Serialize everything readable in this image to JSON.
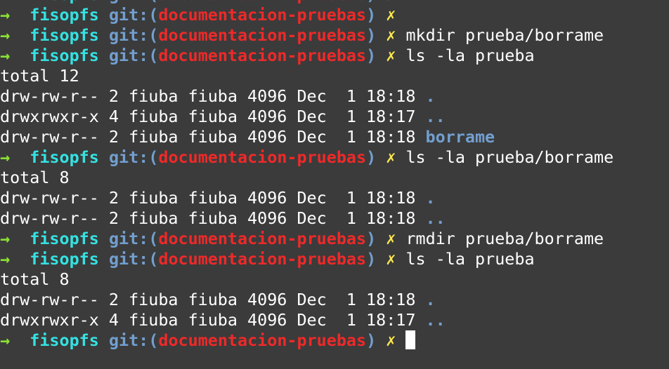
{
  "prompt": {
    "arrow": "→",
    "dir": "fisopfs",
    "git_open": "git:(",
    "branch": "documentacion-pruebas",
    "git_close": ")",
    "dirty": "✗"
  },
  "colors": {
    "background": "#3b3b3b",
    "arrow": "#8ae234",
    "dir": "#34e2e2",
    "git": "#729fcf",
    "branch": "#ef2929",
    "dirty": "#fce94f"
  },
  "lines": [
    {
      "type": "prompt",
      "cmd": ""
    },
    {
      "type": "prompt",
      "cmd": ""
    },
    {
      "type": "prompt",
      "cmd": "mkdir prueba/borrame"
    },
    {
      "type": "prompt",
      "cmd": "ls -la prueba"
    },
    {
      "type": "out",
      "text": "total 12"
    },
    {
      "type": "out",
      "text": "drw-rw-r-- 2 fiuba fiuba 4096 Dec  1 18:18 ",
      "name": "."
    },
    {
      "type": "out",
      "text": "drwxrwxr-x 4 fiuba fiuba 4096 Dec  1 18:17 ",
      "name": ".."
    },
    {
      "type": "out",
      "text": "drw-rw-r-- 2 fiuba fiuba 4096 Dec  1 18:18 ",
      "name": "borrame"
    },
    {
      "type": "prompt",
      "cmd": "ls -la prueba/borrame"
    },
    {
      "type": "out",
      "text": "total 8"
    },
    {
      "type": "out",
      "text": "drw-rw-r-- 2 fiuba fiuba 4096 Dec  1 18:18 ",
      "name": "."
    },
    {
      "type": "out",
      "text": "drw-rw-r-- 2 fiuba fiuba 4096 Dec  1 18:18 ",
      "name": ".."
    },
    {
      "type": "prompt",
      "cmd": "rmdir prueba/borrame"
    },
    {
      "type": "prompt",
      "cmd": "ls -la prueba"
    },
    {
      "type": "out",
      "text": "total 8"
    },
    {
      "type": "out",
      "text": "drw-rw-r-- 2 fiuba fiuba 4096 Dec  1 18:18 ",
      "name": "."
    },
    {
      "type": "out",
      "text": "drwxrwxr-x 4 fiuba fiuba 4096 Dec  1 18:17 ",
      "name": ".."
    },
    {
      "type": "prompt",
      "cmd": "",
      "cursor": true
    }
  ]
}
